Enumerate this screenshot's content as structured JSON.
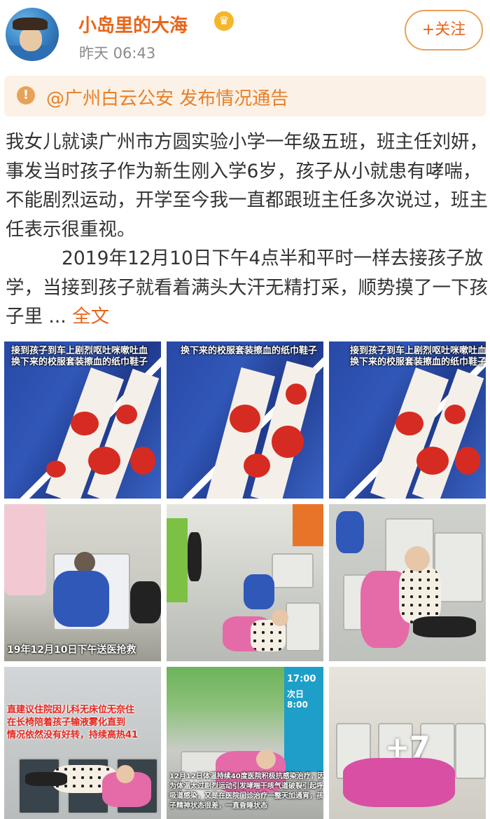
{
  "header": {
    "username": "小岛里的大海",
    "timestamp": "昨天 06:43",
    "follow_label": "+关注",
    "vip_icon": "crown-icon",
    "accent_color": "#e8651a"
  },
  "notice": {
    "icon": "warning-icon",
    "text": "@广州白云公安 发布情况通告"
  },
  "post": {
    "paragraph1": "我女儿就读广州市方圆实验小学一年级五班，班主任刘妍，事发当时孩子作为新生刚入学6岁，孩子从小就患有哮喘，不能剧烈运动，开学至今我一直都跟班主任多次说过，班主任表示很重视。",
    "paragraph2": "2019年12月10日下午4点半和平时一样去接孩子放学，当接到孩子就看着满头大汗无精打采，顺势摸了一下孩子里 ...",
    "more_link": "全文"
  },
  "photos": {
    "p1_caption1": "接到孩子到车上剧烈呕吐咪嗽吐血",
    "p1_caption2": "换下来的校服套装擦血的纸巾鞋子",
    "p2_caption": "换下来的校服套装擦血的纸巾鞋子",
    "p3_caption1": "接到孩子到车上剧烈呕吐咪嗽吐血",
    "p3_caption2": "换下来的校服套装擦血的纸巾鞋子",
    "p4_caption": "19年12月10日下午送医抢救",
    "p7_caption1": "直建议住院因儿科无床位无奈住",
    "p7_caption2": "在长椅陪着孩子输液雾化直到",
    "p7_caption3": "情况依然没有好转，持续高热41",
    "p8_board1": "17:00",
    "p8_board2": "次日8:00",
    "p8_caption1": "12月12日体温持续40度医院积极抗感染治疗，因",
    "p8_caption2": "为体温太过剧烈运动引发哮喘干咳气道破裂引起呼",
    "p8_caption3": "吸道感染，又是在医院门诊治疗一整天加通宵，孩",
    "p8_caption4": "子精神状态很差，一直昏睡状态",
    "more_count": "+7"
  }
}
